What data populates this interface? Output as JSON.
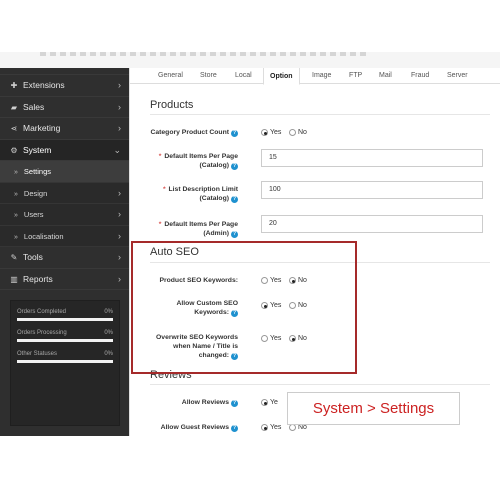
{
  "sidebar": {
    "items": [
      {
        "label": "Extensions",
        "icon": "puzzle-icon"
      },
      {
        "label": "Sales",
        "icon": "cart-icon"
      },
      {
        "label": "Marketing",
        "icon": "share-icon"
      },
      {
        "label": "System",
        "icon": "gear-icon"
      },
      {
        "label": "Tools",
        "icon": "wrench-icon"
      },
      {
        "label": "Reports",
        "icon": "bar-chart-icon"
      }
    ],
    "submenu": [
      {
        "label": "Settings"
      },
      {
        "label": "Design"
      },
      {
        "label": "Users"
      },
      {
        "label": "Localisation"
      }
    ],
    "stats": [
      {
        "label": "Orders Completed",
        "value": "0%"
      },
      {
        "label": "Orders Processing",
        "value": "0%"
      },
      {
        "label": "Other Statuses",
        "value": "0%"
      }
    ]
  },
  "tabs": [
    "General",
    "Store",
    "Local",
    "Option",
    "Image",
    "FTP",
    "Mail",
    "Fraud",
    "Server"
  ],
  "products": {
    "title": "Products",
    "category_count": {
      "label": "Category Product Count",
      "yes": "Yes",
      "no": "No",
      "selected": "Yes"
    },
    "items_per_page_catalog": {
      "label1": "Default Items Per Page",
      "label2": "(Catalog)",
      "value": "15"
    },
    "list_desc_limit": {
      "label1": "List Description Limit",
      "label2": "(Catalog)",
      "value": "100"
    },
    "items_per_page_admin": {
      "label1": "Default Items Per Page",
      "label2": "(Admin)",
      "value": "20"
    }
  },
  "autoseo": {
    "title": "Auto SEO",
    "product_keywords": {
      "label": "Product SEO Keywords:",
      "yes": "Yes",
      "no": "No",
      "selected": "No"
    },
    "allow_custom": {
      "label1": "Allow Custom SEO",
      "label2": "Keywords:",
      "yes": "Yes",
      "no": "No",
      "selected": "Yes"
    },
    "overwrite": {
      "label1": "Overwrite SEO Keywords",
      "label2": "when Name / Title is",
      "label3": "changed:",
      "yes": "Yes",
      "no": "No",
      "selected": "No"
    }
  },
  "reviews": {
    "title": "Reviews",
    "allow_reviews": {
      "label": "Allow Reviews",
      "yes": "Ye"
    },
    "allow_guest": {
      "label": "Allow Guest Reviews",
      "yes": "Yes",
      "no": "No",
      "selected": "Yes"
    }
  },
  "callout": {
    "text": "System > Settings"
  },
  "colors": {
    "sidebar_bg": "#2f2f2f",
    "highlight_border": "#a52a2a",
    "callout_text": "#cc2222",
    "help_icon": "#1e91cf",
    "required": "#d9534f"
  }
}
